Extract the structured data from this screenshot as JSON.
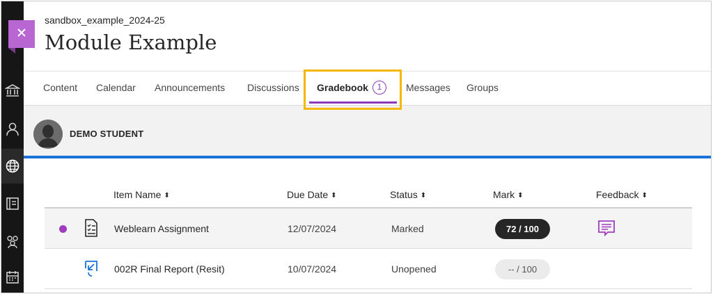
{
  "course": {
    "code": "sandbox_example_2024-25",
    "title": "Module Example"
  },
  "nav_rail": {
    "items": [
      "close-icon",
      "institution-icon",
      "profile-icon",
      "courses-globe-icon",
      "organizations-icon",
      "groups-icon",
      "calendar-icon"
    ]
  },
  "tabs": [
    {
      "label": "Content"
    },
    {
      "label": "Calendar"
    },
    {
      "label": "Announcements"
    },
    {
      "label": "Discussions"
    },
    {
      "label": "Gradebook",
      "badge": "1",
      "active": true
    },
    {
      "label": "Messages"
    },
    {
      "label": "Groups"
    }
  ],
  "student": {
    "name": "DEMO STUDENT"
  },
  "table": {
    "columns": [
      "Item Name",
      "Due Date",
      "Status",
      "Mark",
      "Feedback"
    ],
    "sort_glyph": "⬍",
    "rows": [
      {
        "new": true,
        "icon": "assignment-icon",
        "name": "Weblearn Assignment",
        "due": "12/07/2024",
        "status": "Marked",
        "mark": "72 / 100",
        "feedback": "feedback-icon"
      },
      {
        "new": false,
        "icon": "turnitin-submission-icon",
        "name": "002R Final Report (Resit)",
        "due": "10/07/2024",
        "status": "Unopened",
        "mark": "-- / 100",
        "feedback": ""
      }
    ]
  },
  "colors": {
    "accent_purple": "#8a3ab9",
    "highlight_yellow": "#f5b800",
    "divider_blue": "#1a73d9",
    "rail_dark": "#161616",
    "close_tab": "#b866d1"
  }
}
